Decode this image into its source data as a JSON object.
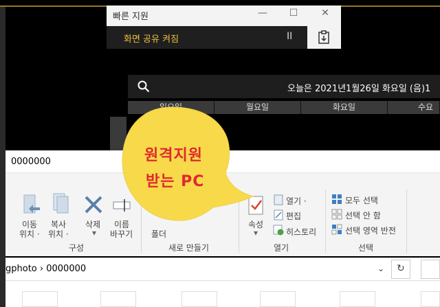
{
  "quick_assist": {
    "title": "빠른 지원",
    "minimize": "—",
    "maximize": "☐",
    "close": "✕",
    "status": "화면 공유 켜짐",
    "pause": "II"
  },
  "calendar": {
    "date": "오늘은 2021년1월26일 화요일 (음)1",
    "days": [
      "일요일",
      "월요일",
      "화요일",
      "수요"
    ]
  },
  "explorer": {
    "title": "0000000",
    "ribbon": {
      "move_to": [
        "이동",
        "위치 ·"
      ],
      "copy_to": [
        "복사",
        "위치 ·"
      ],
      "delete": "삭제",
      "rename": [
        "이름",
        "바꾸기"
      ],
      "new_folder": "폴더",
      "properties": "속성",
      "open": "열기 ·",
      "edit": "편집",
      "history": "히스토리",
      "select_all": "모두 선택",
      "select_none": "선택 안 함",
      "invert_selection": "선택 영역 반전",
      "groups": {
        "organize": "구성",
        "new": "새로 만들기",
        "open": "열기",
        "select": "선택"
      }
    },
    "address": {
      "path_root": "gphoto",
      "separator": "›",
      "folder": "0000000"
    }
  },
  "annotation": {
    "line1": "원격지원",
    "line2": "받는 PC"
  }
}
